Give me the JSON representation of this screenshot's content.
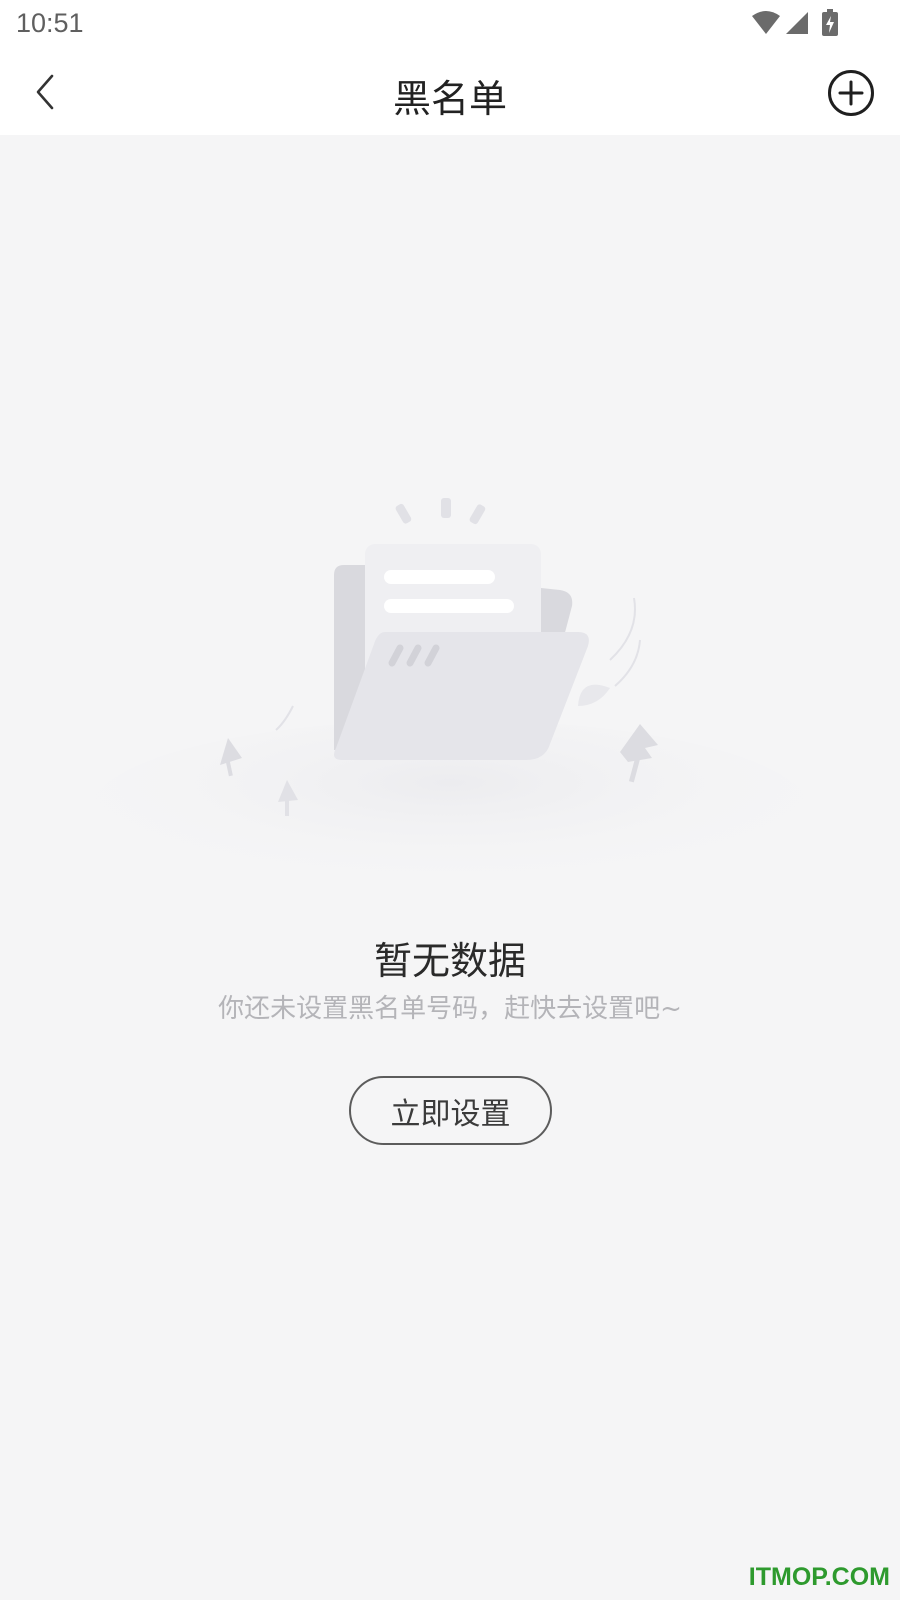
{
  "status_bar": {
    "time": "10:51"
  },
  "nav": {
    "title": "黑名单"
  },
  "empty_state": {
    "title": "暂无数据",
    "description": "你还未设置黑名单号码，赶快去设置吧~",
    "button_label": "立即设置"
  },
  "watermark": "ITMOP.COM",
  "icons": {
    "back": "chevron-left-icon",
    "add": "plus-circle-icon",
    "wifi": "wifi-icon",
    "signal": "signal-icon",
    "battery": "battery-charging-icon"
  },
  "colors": {
    "page_background": "#f5f5f6",
    "watermark": "#2e9a2e"
  }
}
